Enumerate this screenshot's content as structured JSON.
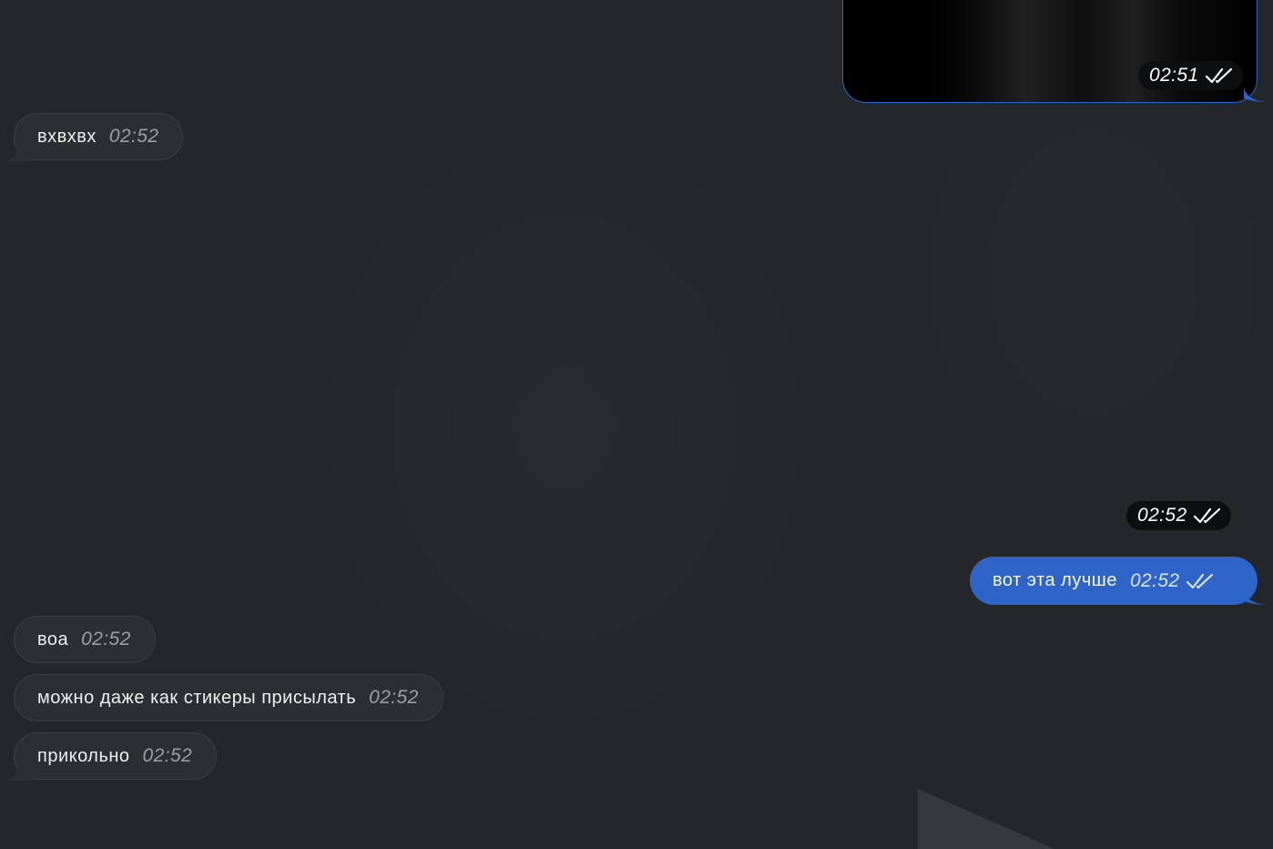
{
  "theme": {
    "background": "#24272a",
    "incoming_bubble": "#2c2f32",
    "outgoing_bubble": "#2e63c8",
    "time_pill": "#0d0e10"
  },
  "messages": [
    {
      "direction": "outgoing",
      "kind": "media",
      "time": "02:51",
      "status_icon": "double-check-icon"
    },
    {
      "direction": "incoming",
      "kind": "text",
      "text": "вхвхвх",
      "time": "02:52"
    },
    {
      "direction": "outgoing",
      "kind": "sticker",
      "time": "02:52",
      "status_icon": "double-check-icon"
    },
    {
      "direction": "outgoing",
      "kind": "text",
      "text": "вот эта лучше",
      "time": "02:52",
      "status_icon": "double-check-icon"
    },
    {
      "direction": "incoming",
      "kind": "text",
      "text": "воа",
      "time": "02:52"
    },
    {
      "direction": "incoming",
      "kind": "text",
      "text": "можно даже как стикеры присылать",
      "time": "02:52"
    },
    {
      "direction": "incoming",
      "kind": "text",
      "text": "прикольно",
      "time": "02:52"
    }
  ]
}
